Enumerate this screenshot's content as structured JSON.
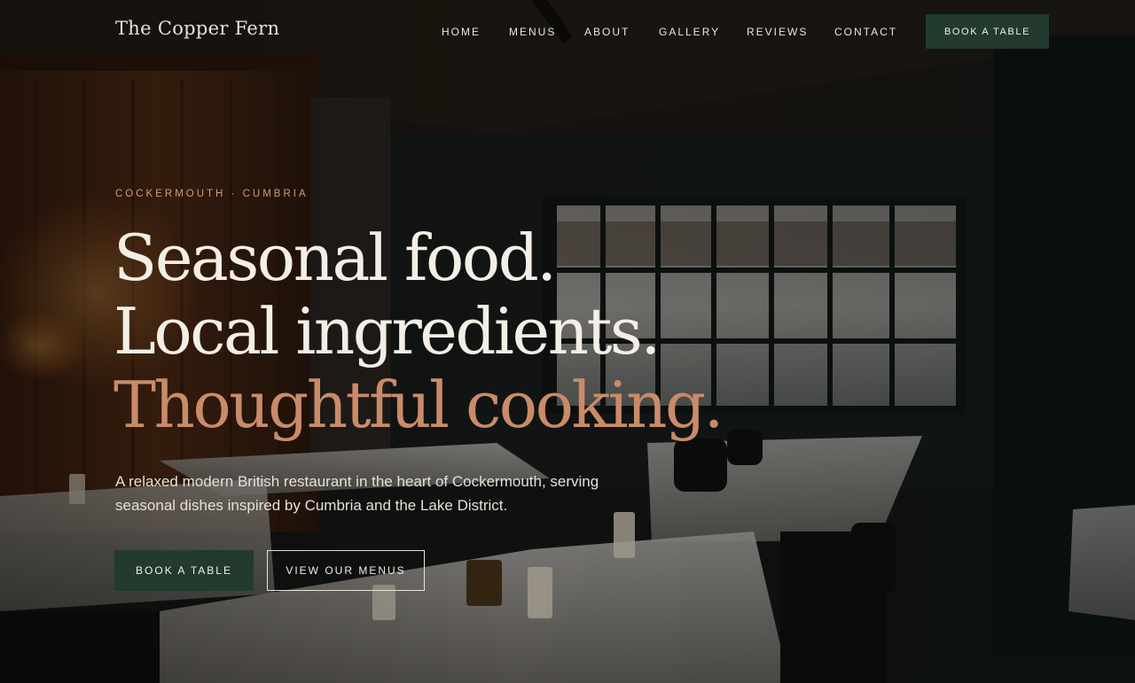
{
  "brand": {
    "name": "The Copper Fern"
  },
  "nav": {
    "items": [
      {
        "label": "HOME"
      },
      {
        "label": "MENUS"
      },
      {
        "label": "ABOUT"
      },
      {
        "label": "GALLERY"
      },
      {
        "label": "REVIEWS"
      },
      {
        "label": "CONTACT"
      }
    ],
    "cta_label": "BOOK A TABLE"
  },
  "hero": {
    "eyebrow": "COCKERMOUTH · CUMBRIA",
    "headline": {
      "line1": "Seasonal food.",
      "line2": "Local ingredients.",
      "line3": "Thoughtful cooking."
    },
    "lead": "A relaxed modern British restaurant in the heart of Cockermouth, serving seasonal dishes inspired by Cumbria and the Lake District.",
    "primary_button": "BOOK A TABLE",
    "secondary_button": "VIEW OUR MENUS"
  },
  "colors": {
    "accent": "#c98b68",
    "brand_green": "#233a2e",
    "text_light": "#f4efe6"
  }
}
